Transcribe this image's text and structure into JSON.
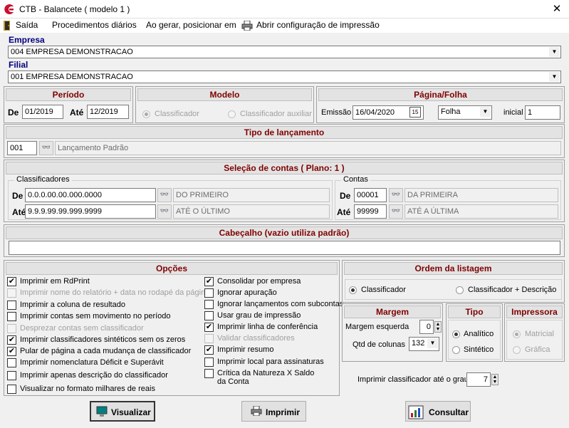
{
  "window": {
    "title": "CTB - Balancete  ( modelo 1 )",
    "close_glyph": "✕",
    "logo_color": "#c8102e"
  },
  "menu": {
    "saida": "Saída",
    "procedimentos": "Procedimentos diários",
    "ao_gerar": "Ao gerar, posicionar em",
    "abrir_config": "Abrir configuração de impressão"
  },
  "empresa": {
    "label": "Empresa",
    "value": "004 EMPRESA DEMONSTRACAO"
  },
  "filial": {
    "label": "Filial",
    "value": "001 EMPRESA DEMONSTRACAO"
  },
  "periodo": {
    "title": "Período",
    "de_label": "De",
    "de_value": "01/2019",
    "ate_label": "Até",
    "ate_value": "12/2019"
  },
  "modelo": {
    "title": "Modelo",
    "opt1": "Classificador",
    "opt2": "Classificador auxiliar"
  },
  "pagina": {
    "title": "Página/Folha",
    "emissao_label": "Emissão",
    "emissao_value": "16/04/2020",
    "folha_value": "Folha",
    "inicial_label": "inicial",
    "inicial_value": "1",
    "cal_glyph": "15"
  },
  "tipo_lanc": {
    "title": "Tipo de lançamento",
    "code": "001",
    "desc": "Lançamento Padrão"
  },
  "selecao": {
    "title": "Seleção de contas  ( Plano: 1 )",
    "class_group": "Classificadores",
    "contas_group": "Contas",
    "de_label": "De",
    "ate_label": "Até",
    "class_de": "0.0.0.00.00.000.0000",
    "class_de_desc": "DO PRIMEIRO",
    "class_ate": "9.9.9.99.99.999.9999",
    "class_ate_desc": "ATÉ O ÚLTIMO",
    "conta_de": "00001",
    "conta_de_desc": "DA PRIMEIRA",
    "conta_ate": "99999",
    "conta_ate_desc": "ATÉ A ÚLTIMA"
  },
  "cabecalho": {
    "title": "Cabeçalho (vazio utiliza padrão)",
    "value": ""
  },
  "opcoes": {
    "title": "Opções",
    "col1": [
      {
        "label": "Imprimir em RdPrint",
        "checked": "✔",
        "disabled": false
      },
      {
        "label": "Imprimir nome do relatório + data no rodapé da página",
        "checked": "",
        "disabled": true
      },
      {
        "label": "Imprimir a coluna de resultado",
        "checked": "",
        "disabled": false
      },
      {
        "label": "Imprimir contas sem movimento no período",
        "checked": "",
        "disabled": false
      },
      {
        "label": "Desprezar contas sem classificador",
        "checked": "",
        "disabled": true
      },
      {
        "label": "Imprimir classificadores sintéticos sem os zeros",
        "checked": "✔",
        "disabled": false
      },
      {
        "label": "Pular de página a cada mudança de classificador",
        "checked": "✔",
        "disabled": false
      },
      {
        "label": "Imprimir nomenclatura Déficit e Superávit",
        "checked": "",
        "disabled": false
      },
      {
        "label": "Imprimir apenas descrição do classificador",
        "checked": "",
        "disabled": false
      },
      {
        "label": "Visualizar no formato milhares de reais",
        "checked": "",
        "disabled": false
      }
    ],
    "col2": [
      {
        "label": "Consolidar por empresa",
        "checked": "✔",
        "disabled": false
      },
      {
        "label": "Ignorar apuração",
        "checked": "",
        "disabled": false
      },
      {
        "label": "Ignorar lançamentos com subcontas",
        "checked": "",
        "disabled": false
      },
      {
        "label": "Usar grau de impressão",
        "checked": "",
        "disabled": false
      },
      {
        "label": "Imprimir linha de conferência",
        "checked": "✔",
        "disabled": false
      },
      {
        "label": "Validar classificadores",
        "checked": "",
        "disabled": true
      },
      {
        "label": "Imprimir resumo",
        "checked": "✔",
        "disabled": false
      },
      {
        "label": "Imprimir local para assinaturas",
        "checked": "",
        "disabled": false
      },
      {
        "label": "Crítica da Natureza X Saldo",
        "label2": "da Conta",
        "checked": "",
        "disabled": false
      }
    ]
  },
  "ordem": {
    "title": "Ordem da listagem",
    "opt1": "Classificador",
    "opt2": "Classificador + Descrição"
  },
  "margem": {
    "title": "Margem",
    "esq_label": "Margem esquerda",
    "esq_value": "0",
    "col_label": "Qtd de colunas",
    "col_value": "132"
  },
  "tipo": {
    "title": "Tipo",
    "opt1": "Analítico",
    "opt2": "Sintético"
  },
  "impressora": {
    "title": "Impressora",
    "opt1": "Matricial",
    "opt2": "Gráfica"
  },
  "grau": {
    "label": "Imprimir classificador até o grau",
    "value": "7"
  },
  "buttons": {
    "visualizar": "Visualizar",
    "imprimir": "Imprimir",
    "consultar": "Consultar"
  }
}
